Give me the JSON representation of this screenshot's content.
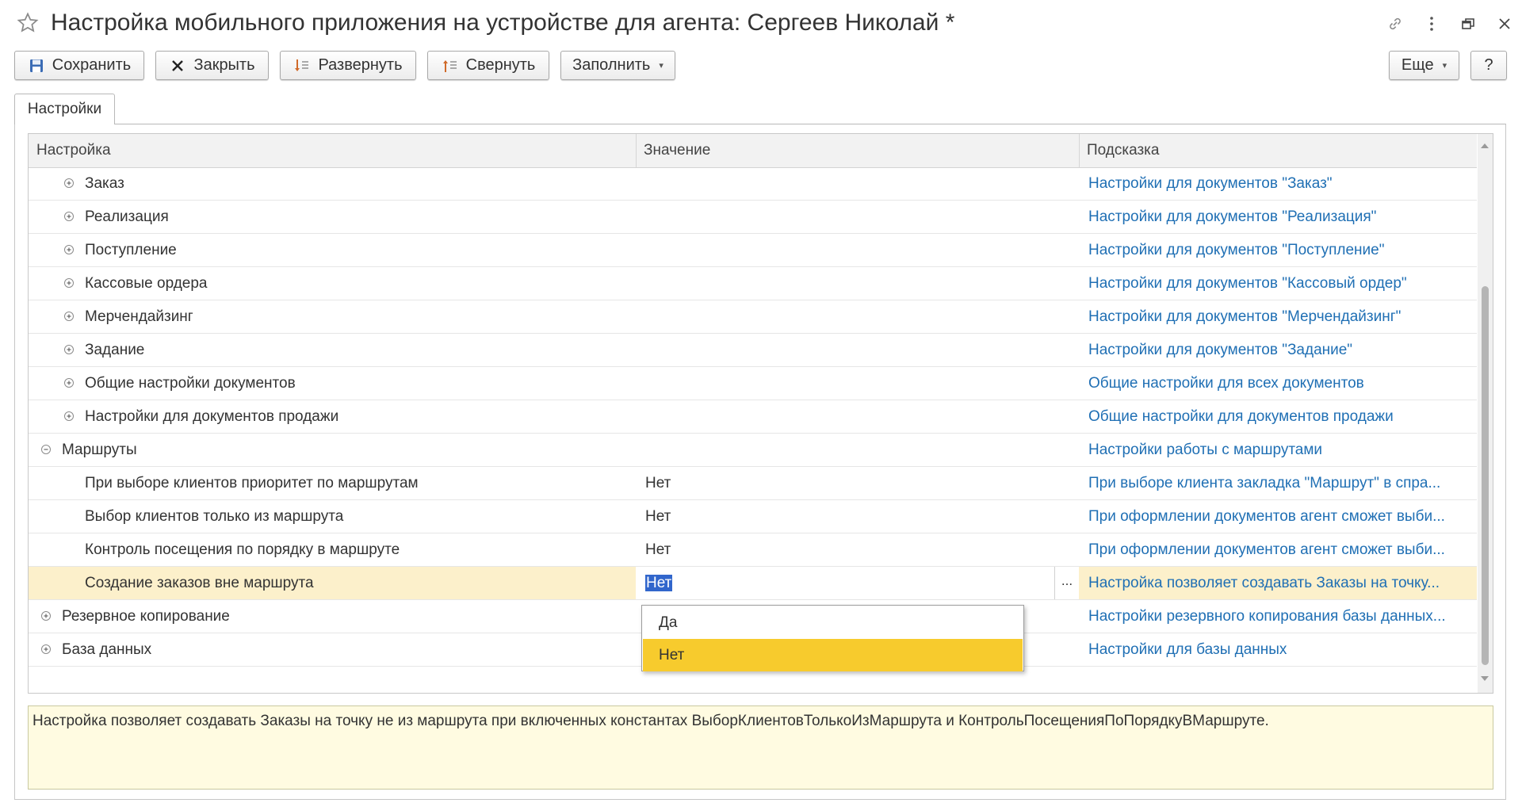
{
  "window": {
    "title": "Настройка мобильного приложения на устройстве для агента: Сергеев Николай *"
  },
  "toolbar": {
    "save_label": "Сохранить",
    "close_label": "Закрыть",
    "expand_label": "Развернуть",
    "collapse_label": "Свернуть",
    "fill_label": "Заполнить",
    "more_label": "Еще",
    "help_label": "?"
  },
  "tabs": [
    {
      "label": "Настройки"
    }
  ],
  "grid": {
    "columns": [
      "Настройка",
      "Значение",
      "Подсказка"
    ],
    "rows": [
      {
        "level": 1,
        "toggle": "plus",
        "name": "Заказ",
        "value": "",
        "hint": "Настройки для документов \"Заказ\""
      },
      {
        "level": 1,
        "toggle": "plus",
        "name": "Реализация",
        "value": "",
        "hint": "Настройки для документов \"Реализация\""
      },
      {
        "level": 1,
        "toggle": "plus",
        "name": "Поступление",
        "value": "",
        "hint": "Настройки для документов \"Поступление\""
      },
      {
        "level": 1,
        "toggle": "plus",
        "name": "Кассовые ордера",
        "value": "",
        "hint": "Настройки для документов \"Кассовый ордер\""
      },
      {
        "level": 1,
        "toggle": "plus",
        "name": "Мерчендайзинг",
        "value": "",
        "hint": "Настройки для документов \"Мерчендайзинг\""
      },
      {
        "level": 1,
        "toggle": "plus",
        "name": "Задание",
        "value": "",
        "hint": "Настройки для документов \"Задание\""
      },
      {
        "level": 1,
        "toggle": "plus",
        "name": "Общие настройки документов",
        "value": "",
        "hint": "Общие настройки для всех документов"
      },
      {
        "level": 1,
        "toggle": "plus",
        "name": "Настройки для документов продажи",
        "value": "",
        "hint": "Общие настройки для документов продажи"
      },
      {
        "level": 0,
        "toggle": "minus",
        "name": "Маршруты",
        "value": "",
        "hint": "Настройки работы с маршрутами"
      },
      {
        "level": 2,
        "toggle": "none",
        "name": "При выборе клиентов приоритет по маршрутам",
        "value": "Нет",
        "hint": "При выборе клиента закладка \"Маршрут\" в спра..."
      },
      {
        "level": 2,
        "toggle": "none",
        "name": "Выбор клиентов только из маршрута",
        "value": "Нет",
        "hint": "При оформлении документов агент сможет выби..."
      },
      {
        "level": 2,
        "toggle": "none",
        "name": "Контроль посещения по порядку в маршруте",
        "value": "Нет",
        "hint": "При оформлении документов агент сможет выби..."
      },
      {
        "level": 2,
        "toggle": "none",
        "name": "Создание заказов вне маршрута",
        "value": "Нет",
        "hint": "Настройка позволяет создавать Заказы на точку...",
        "selected": true
      },
      {
        "level": 0,
        "toggle": "plus",
        "name": "Резервное копирование",
        "value": "",
        "hint": "Настройки резервного копирования базы данных..."
      },
      {
        "level": 0,
        "toggle": "plus",
        "name": "База данных",
        "value": "",
        "hint": "Настройки для базы данных"
      }
    ]
  },
  "dropdown": {
    "options": [
      "Да",
      "Нет"
    ],
    "highlighted": "Нет"
  },
  "description": {
    "text": "Настройка позволяет создавать Заказы на точку не из маршрута при включенных константах ВыборКлиентовТолькоИзМаршрута и КонтрольПосещенияПоПорядкуВМаршруте."
  },
  "colors": {
    "link": "#1f6fb4",
    "selected_row": "#fcf0cb",
    "dropdown_highlight": "#f7cb2d",
    "description_bg": "#fffbe1",
    "text_selection": "#3166cc"
  },
  "icons": {
    "favorite": "star-icon",
    "link": "link-icon",
    "menu": "kebab-icon",
    "restore": "restore-window-icon",
    "close": "close-icon",
    "save": "floppy-icon",
    "close_form": "x-icon",
    "expand": "expand-tree-icon",
    "collapse": "collapse-tree-icon"
  }
}
